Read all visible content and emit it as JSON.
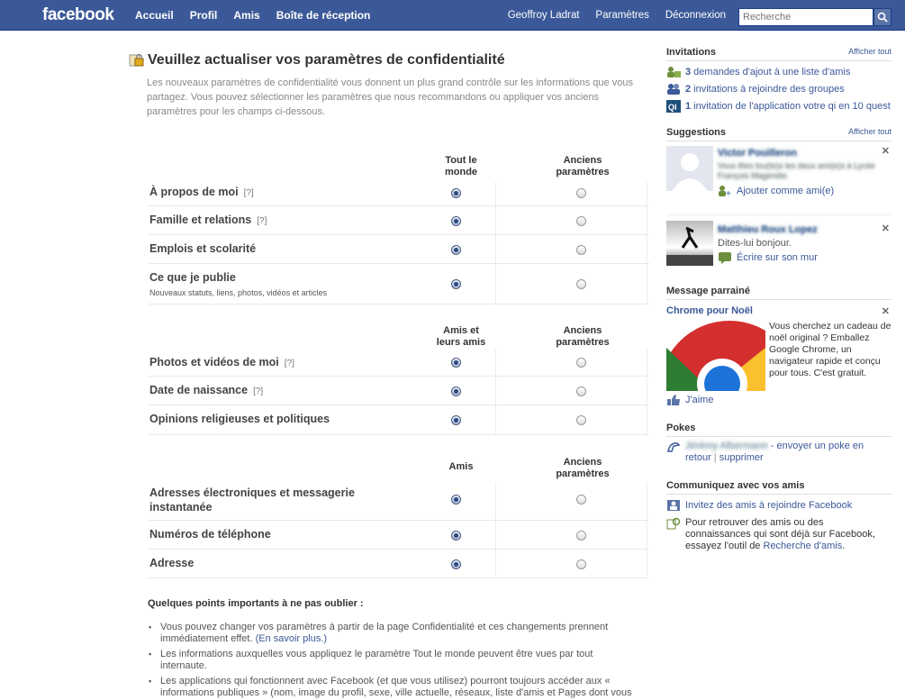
{
  "header": {
    "logo": "facebook",
    "nav_left": [
      "Accueil",
      "Profil",
      "Amis",
      "Boîte de réception"
    ],
    "nav_right": [
      "Geoffroy Ladrat",
      "Paramètres",
      "Déconnexion"
    ],
    "search_placeholder": "Recherche"
  },
  "main": {
    "title": "Veuillez actualiser vos paramètres de confidentialité",
    "intro": "Les nouveaux paramètres de confidentialité vous donnent un plus grand contrôle sur les informations que vous partagez. Vous pouvez sélectionner les paramètres que nous recommandons ou appliquer vos anciens paramètres pour les champs ci-dessous.",
    "sections": [
      {
        "col1": "Tout le monde",
        "col2": "Anciens paramètres",
        "rows": [
          {
            "label": "À propos de moi",
            "help": "[?]",
            "sub": ""
          },
          {
            "label": "Famille et relations",
            "help": "[?]",
            "sub": ""
          },
          {
            "label": "Emplois et scolarité",
            "help": "",
            "sub": ""
          },
          {
            "label": "Ce que je publie",
            "help": "",
            "sub": "Nouveaux statuts, liens, photos, vidéos et articles"
          }
        ]
      },
      {
        "col1": "Amis et leurs amis",
        "col2": "Anciens paramètres",
        "rows": [
          {
            "label": "Photos et vidéos de moi",
            "help": "[?]",
            "sub": ""
          },
          {
            "label": "Date de naissance",
            "help": "[?]",
            "sub": ""
          },
          {
            "label": "Opinions religieuses et politiques",
            "help": "",
            "sub": ""
          }
        ]
      },
      {
        "col1": "Amis",
        "col2": "Anciens paramètres",
        "rows": [
          {
            "label": "Adresses électroniques et messagerie instantanée",
            "help": "",
            "sub": ""
          },
          {
            "label": "Numéros de téléphone",
            "help": "",
            "sub": ""
          },
          {
            "label": "Adresse",
            "help": "",
            "sub": ""
          }
        ]
      }
    ],
    "notes_title": "Quelques points importants à ne pas oublier :",
    "notes": [
      {
        "text": "Vous pouvez changer vos paramètres à partir de la page Confidentialité et ces changements prennent immédiatement effet.",
        "link": "(En savoir plus.)"
      },
      {
        "text": "Les informations auxquelles vous appliquez le paramètre Tout le monde peuvent être vues par tout internaute.",
        "link": ""
      },
      {
        "text": "Les applications qui fonctionnent avec Facebook (et que vous utilisez) pourront toujours accéder aux « informations publiques » (nom, image du profil, sexe, ville actuelle, réseaux, liste d'amis et Pages dont vous êtes fan). Ces informations tombent sous le paramètre Tout le monde.",
        "link": ""
      }
    ]
  },
  "sidebar": {
    "invitations_title": "Invitations",
    "see_all": "Afficher tout",
    "invitations": [
      {
        "count": "3",
        "text": " demandes d'ajout à une liste d'amis"
      },
      {
        "count": "2",
        "text": " invitations à rejoindre des groupes"
      },
      {
        "count": "1",
        "text": " invitation de l'application votre qi en 10 quest"
      }
    ],
    "suggestions_title": "Suggestions",
    "suggestion1_name": "Victor Pouilleron",
    "suggestion1_desc": "Vous êtes tou(te)s les deux ami(e)s à Lycée François Magendie.",
    "suggestion1_action": "Ajouter comme ami(e)",
    "suggestion2_name": "Matthieu Roux Lopez",
    "suggestion2_desc": "Dites-lui bonjour.",
    "suggestion2_action": "Écrire sur son mur",
    "sponsored_title": "Message parrainé",
    "ad_title": "Chrome pour Noël",
    "ad_text": "Vous cherchez un cadeau de noël original ? Emballez Google Chrome, un navigateur rapide et conçu pour tous. C'est gratuit.",
    "like": "J'aime",
    "pokes_title": "Pokes",
    "poke_name": "Jérémy Albermann",
    "poke_text": " - envoyer un poke en retour",
    "poke_sep": " | ",
    "poke_delete": "supprimer",
    "connect_title": "Communiquez avec vos amis",
    "connect_invite": "Invitez des amis à rejoindre Facebook",
    "connect_text": "Pour retrouver des amis ou des connaissances qui sont déjà sur Facebook, essayez l'outil de",
    "connect_link": "Recherche d'amis",
    "connect_end": "."
  }
}
